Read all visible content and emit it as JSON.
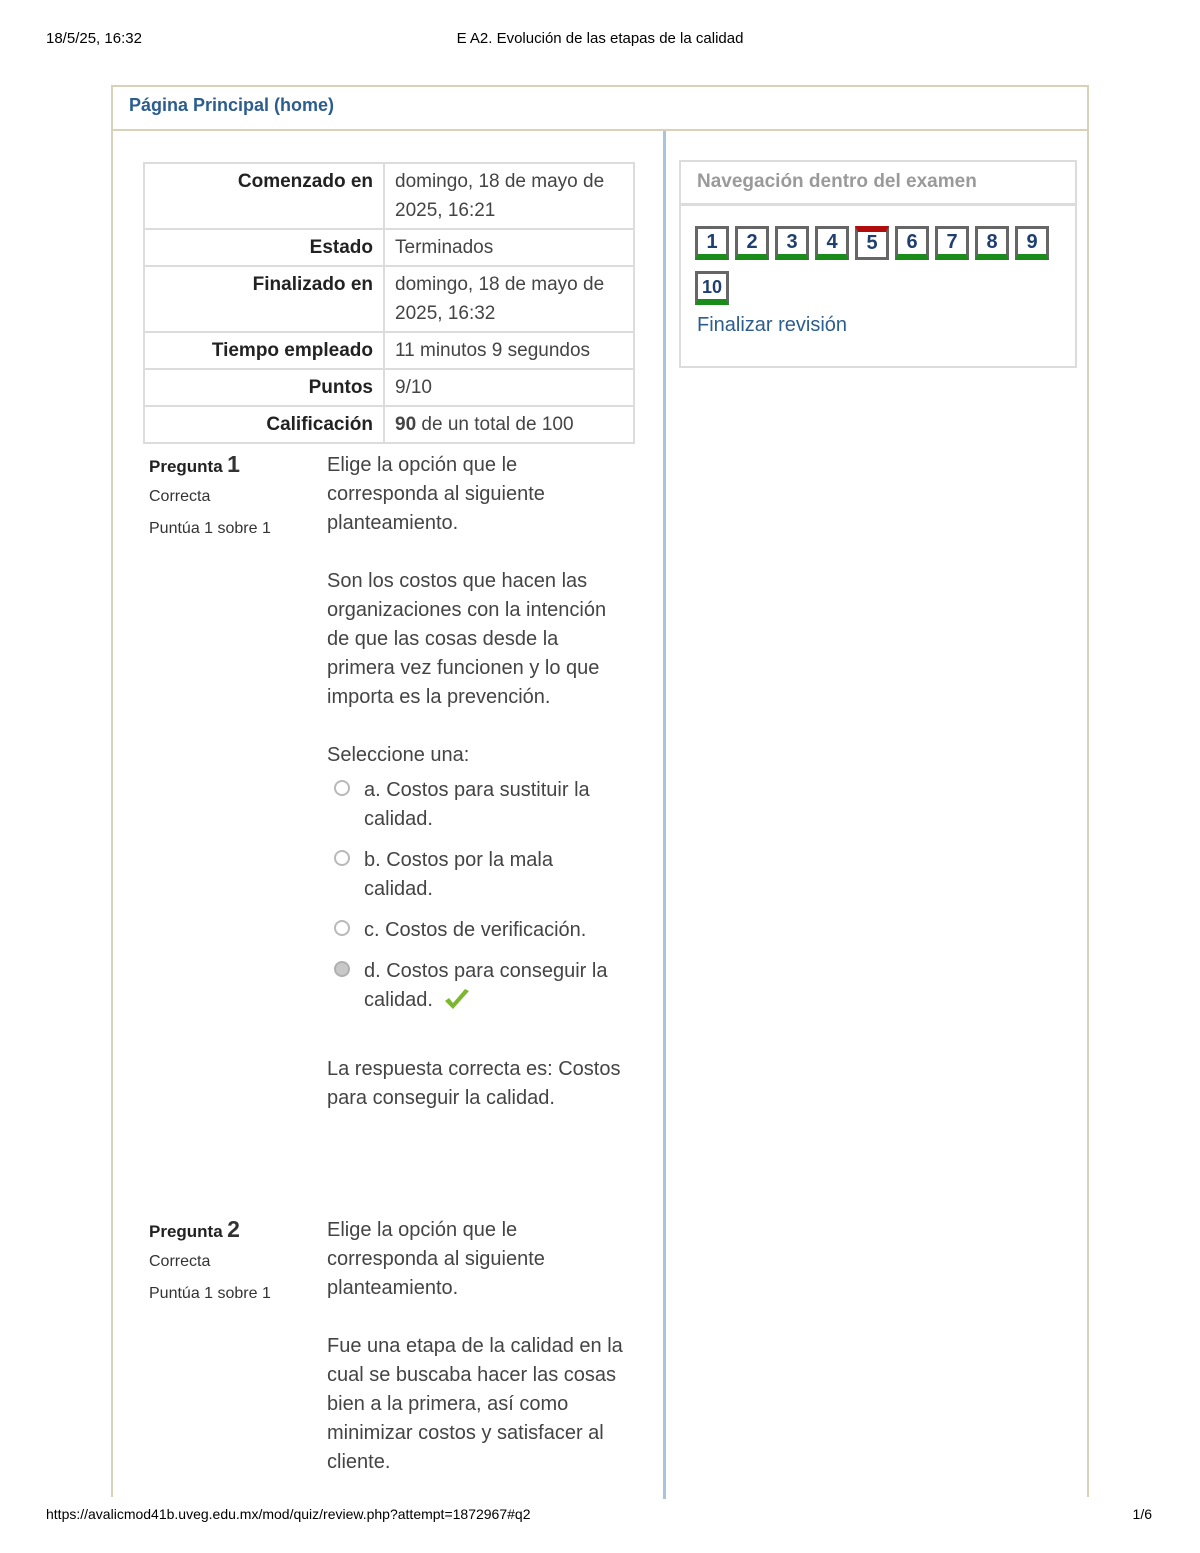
{
  "print": {
    "date": "18/5/25, 16:32",
    "title": "E A2. Evolución de las etapas de la calidad",
    "url": "https://avalicmod41b.uveg.edu.mx/mod/quiz/review.php?attempt=1872967#q2",
    "page": "1/6"
  },
  "header": {
    "home_link": "Página Principal (home)"
  },
  "summary": [
    {
      "label": "Comenzado en",
      "value": "domingo, 18 de mayo de 2025, 16:21"
    },
    {
      "label": "Estado",
      "value": "Terminados"
    },
    {
      "label": "Finalizado en",
      "value": "domingo, 18 de mayo de 2025, 16:32"
    },
    {
      "label": "Tiempo empleado",
      "value": "11 minutos 9 segundos"
    },
    {
      "label": "Puntos",
      "value": "9/10"
    },
    {
      "label": "Calificación",
      "value_bold": "90",
      "value_rest": " de un total de 100"
    }
  ],
  "questions": [
    {
      "label": "Pregunta",
      "number": "1",
      "state": "Correcta",
      "marks": "Puntúa 1 sobre 1",
      "prompt": "Elige la opción que le corresponda al siguiente planteamiento.",
      "statement": "Son los costos que hacen las organizaciones con la intención de que las cosas desde la primera vez funcionen y lo que importa es la prevención.",
      "select_label": "Seleccione una:",
      "options": [
        "a. Costos para sustituir la calidad.",
        "b. Costos por la mala calidad.",
        "c. Costos de verificación.",
        "d. Costos para conseguir la calidad."
      ],
      "right_answer": "La respuesta correcta es: Costos para conseguir la calidad."
    },
    {
      "label": "Pregunta",
      "number": "2",
      "state": "Correcta",
      "marks": "Puntúa 1 sobre 1",
      "prompt": "Elige la opción que le corresponda al siguiente planteamiento.",
      "statement": "Fue una etapa de la calidad en la cual se buscaba hacer las cosas bien a la primera, así como minimizar costos y satisfacer al cliente."
    }
  ],
  "navigation": {
    "title": "Navegación dentro del examen",
    "buttons": [
      "1",
      "2",
      "3",
      "4",
      "5",
      "6",
      "7",
      "8",
      "9",
      "10"
    ],
    "finish_link": "Finalizar revisión"
  },
  "colors": {
    "correct": "#1a8c1a",
    "incorrect": "#b10d0d",
    "link": "#2c5d8f"
  }
}
